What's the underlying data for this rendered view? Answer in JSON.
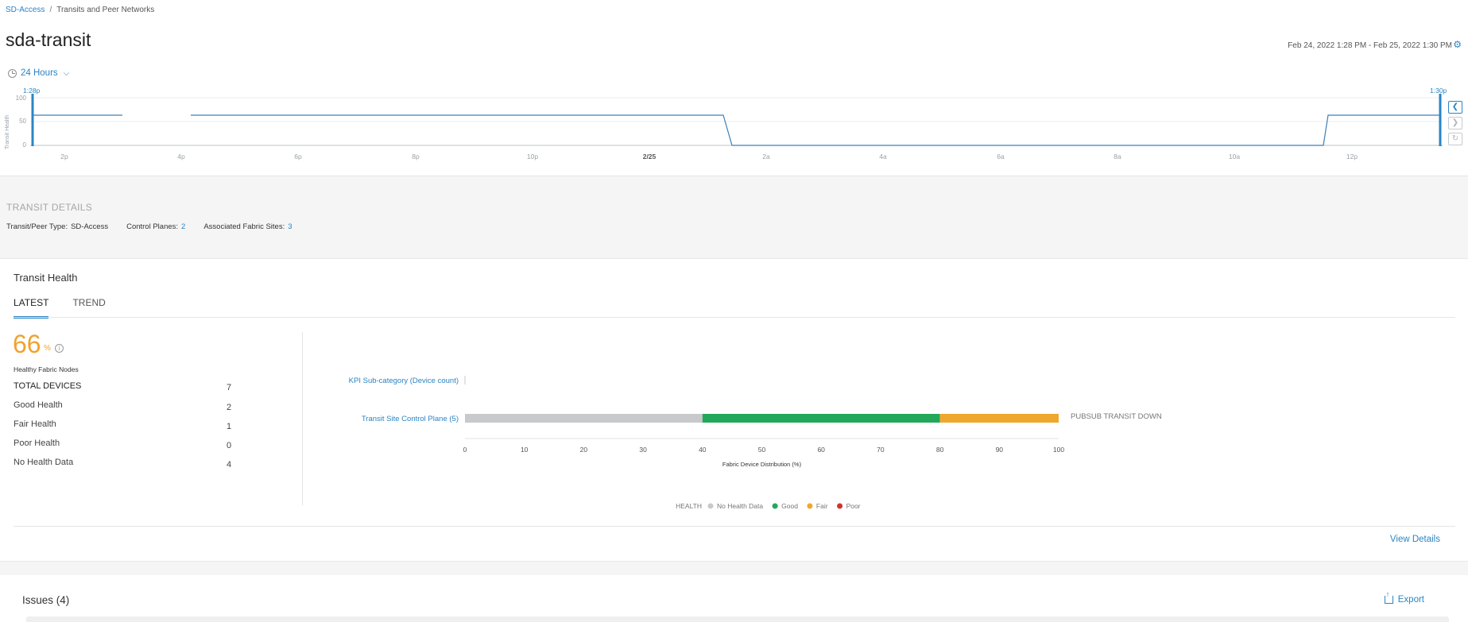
{
  "breadcrumb": {
    "root": "SD-Access",
    "current": "Transits and Peer Networks"
  },
  "page_title": "sda-transit",
  "time_range": "Feb 24, 2022 1:28 PM - Feb 25, 2022 1:30 PM",
  "time_select": "24 Hours",
  "timeline": {
    "y_label": "Transit Health",
    "y_ticks": [
      "100",
      "50",
      "0"
    ],
    "start_marker": "1:28p",
    "end_marker": "1:30p",
    "x_ticks": [
      "2p",
      "4p",
      "6p",
      "8p",
      "10p",
      "2/25",
      "2a",
      "4a",
      "6a",
      "8a",
      "10a",
      "12p"
    ]
  },
  "transit_details": {
    "title": "TRANSIT DETAILS",
    "type_label": "Transit/Peer Type:",
    "type_value": "SD-Access",
    "cp_label": "Control Planes:",
    "cp_value": "2",
    "sites_label": "Associated Fabric Sites:",
    "sites_value": "3"
  },
  "health": {
    "title": "Transit Health",
    "tabs": [
      "LATEST",
      "TREND"
    ],
    "percent": "66",
    "percent_sign": "%",
    "healthy_label": "Healthy Fabric Nodes",
    "stats": [
      {
        "label": "TOTAL DEVICES",
        "value": "7"
      },
      {
        "label": "Good Health",
        "value": "2"
      },
      {
        "label": "Fair Health",
        "value": "1"
      },
      {
        "label": "Poor Health",
        "value": "0"
      },
      {
        "label": "No Health Data",
        "value": "4"
      }
    ],
    "view_details": "View Details"
  },
  "chart_data": {
    "type": "bar",
    "orientation": "horizontal-stacked",
    "category_header": "KPI Sub-category (Device count)",
    "categories": [
      "Transit Site Control Plane (5)"
    ],
    "series": [
      {
        "name": "No Health Data",
        "values": [
          40
        ],
        "color": "#c8c9ca"
      },
      {
        "name": "Good",
        "values": [
          40
        ],
        "color": "#22a85a"
      },
      {
        "name": "Fair",
        "values": [
          20
        ],
        "color": "#f0a72d"
      },
      {
        "name": "Poor",
        "values": [
          0
        ],
        "color": "#d0342c"
      }
    ],
    "bar_annotation": "PUBSUB TRANSIT DOWN",
    "xlabel": "Fabric Device Distribution (%)",
    "xlim": [
      0,
      100
    ],
    "x_ticks": [
      "0",
      "10",
      "20",
      "30",
      "40",
      "50",
      "60",
      "70",
      "80",
      "90",
      "100"
    ],
    "legend_title": "HEALTH",
    "legend_position": "bottom"
  },
  "issues": {
    "title": "Issues (4)",
    "export": "Export"
  },
  "colors": {
    "accent": "#2b84c4",
    "fair": "#f0a72d",
    "good": "#22a85a",
    "poor": "#d0342c"
  },
  "icons": {
    "settings": "gear-icon",
    "time": "clock-icon",
    "info": "info-icon",
    "export": "export-icon"
  }
}
